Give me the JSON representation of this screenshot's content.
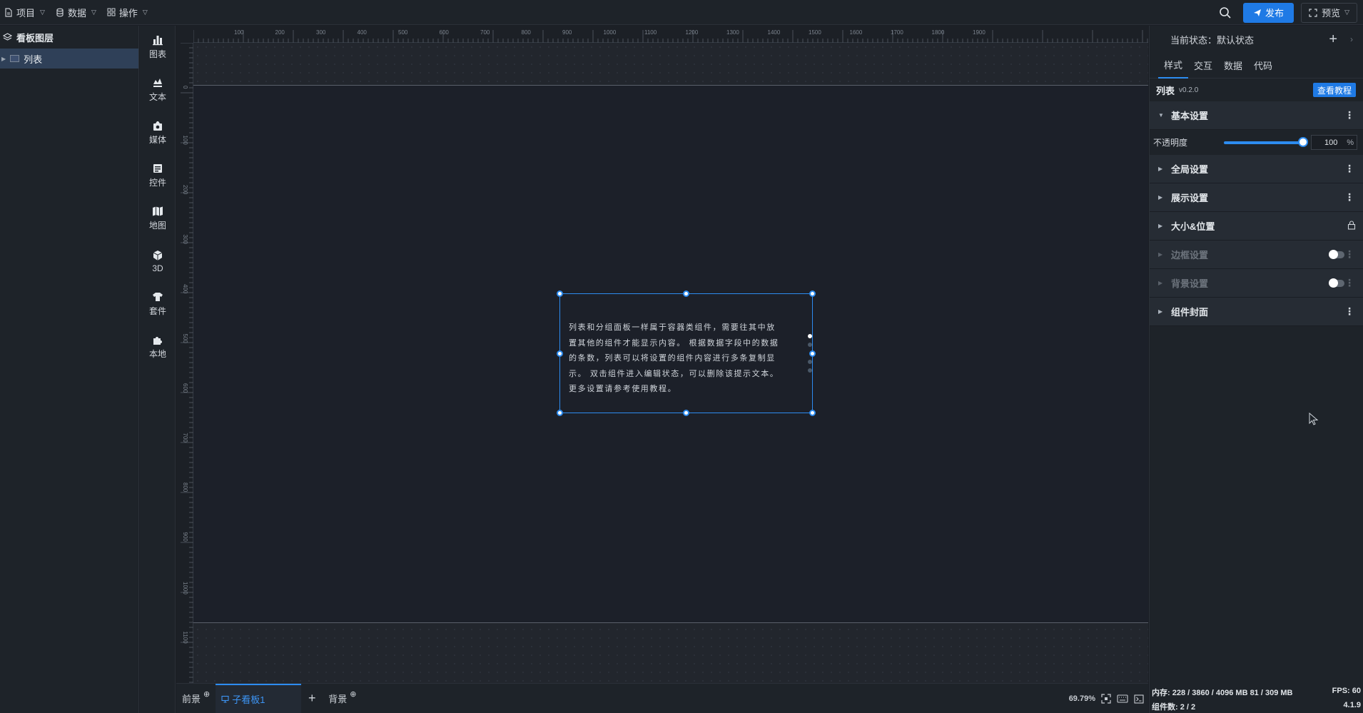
{
  "topbar": {
    "menus": [
      {
        "label": "项目"
      },
      {
        "label": "数据"
      },
      {
        "label": "操作"
      }
    ],
    "publish_label": "发布",
    "preview_label": "预览"
  },
  "layers": {
    "header": "看板图层",
    "items": [
      {
        "label": "列表"
      }
    ]
  },
  "components": [
    {
      "label": "图表",
      "icon": "bar-chart-icon"
    },
    {
      "label": "文本",
      "icon": "text-icon"
    },
    {
      "label": "媒体",
      "icon": "media-icon"
    },
    {
      "label": "控件",
      "icon": "control-icon"
    },
    {
      "label": "地图",
      "icon": "map-icon"
    },
    {
      "label": "3D",
      "icon": "cube-icon"
    },
    {
      "label": "套件",
      "icon": "kit-icon"
    },
    {
      "label": "本地",
      "icon": "puzzle-icon"
    }
  ],
  "ruler": {
    "h_labels": [
      "100",
      "200",
      "300",
      "400",
      "500",
      "600",
      "700",
      "800",
      "900",
      "1000",
      "1100",
      "1200",
      "1300",
      "1400",
      "1500",
      "1600",
      "1700",
      "1800",
      "1900"
    ],
    "v_labels": [
      "0",
      "100",
      "200",
      "300",
      "400",
      "500",
      "600",
      "700",
      "800",
      "900",
      "1000",
      "1100"
    ]
  },
  "widget": {
    "text_lines": [
      "列表和分组面板一样属于容器类组件，需要往其中放",
      "置其他的组件才能显示内容。 根据数据字段中的数据",
      "的条数，列表可以将设置的组件内容进行多条复制显",
      "示。 双击组件进入编辑状态，可以删除该提示文本。",
      "更多设置请参考使用教程。"
    ]
  },
  "bottom_tabs": {
    "foreground": "前景",
    "subboard": "子看板1",
    "background": "背景",
    "zoom": "69.79%"
  },
  "panel": {
    "state_label": "当前状态：",
    "state_value": "默认状态",
    "tabs": [
      "样式",
      "交互",
      "数据",
      "代码"
    ],
    "active_tab": "样式",
    "component_name": "列表",
    "component_version": "v0.2.0",
    "tutorial_label": "查看教程",
    "basic_section": "基本设置",
    "opacity_label": "不透明度",
    "opacity_value": "100",
    "opacity_unit": "%",
    "opacity_level": 100,
    "sections": [
      {
        "label": "全局设置"
      },
      {
        "label": "展示设置"
      },
      {
        "label": "大小&位置"
      },
      {
        "label": "边框设置"
      },
      {
        "label": "背景设置"
      },
      {
        "label": "组件封面"
      }
    ]
  },
  "status": {
    "memory": "内存: 228 / 3860 / 4096 MB  81 / 309 MB",
    "fps": "FPS: 60",
    "count": "组件数: 2 / 2",
    "version": "4.1.9"
  },
  "colors": {
    "accent": "#1f7ae5",
    "selection": "#2d8cf0",
    "board": "#1c2029",
    "panel": "#1e2329"
  }
}
